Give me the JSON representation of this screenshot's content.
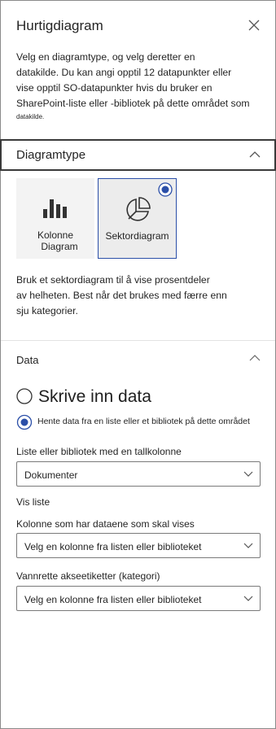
{
  "header": {
    "title": "Hurtigdiagram",
    "close_icon": "close-icon"
  },
  "intro": {
    "lines": [
      "Velg en diagramtype, og velg deretter en",
      "datakilde. Du kan angi opptil 12 datapunkter eller",
      "vise opptil SO-datapunkter hvis du bruker en",
      "SharePoint-liste eller -bibliotek på dette området som"
    ],
    "tiny": "datakilde."
  },
  "chart_type_section": {
    "label": "Diagramtype",
    "icon": "chevron-up-icon"
  },
  "chart_types": {
    "column": {
      "line1": "Kolonne",
      "line2": "Diagram",
      "icon": "column-chart-icon"
    },
    "pie": {
      "label": "Sektordiagram",
      "icon": "pie-chart-icon",
      "selected": true
    }
  },
  "description": {
    "lines": [
      "Bruk et sektordiagram til å vise prosentdeler",
      "av helheten. Best når det brukes med færre enn",
      "sju kategorier."
    ]
  },
  "data_section": {
    "label": "Data",
    "icon": "chevron-up-icon"
  },
  "source": {
    "manual_label": "Skrive inn data",
    "list_label": "Hente data fra en liste eller et bibliotek på dette området",
    "selected": "list"
  },
  "fields": {
    "list_label": "Liste eller bibliotek med en tallkolonne",
    "list_value": "Dokumenter",
    "show_list": "Vis liste",
    "column_label": "Kolonne som har dataene som skal vises",
    "column_value": "Velg en kolonne fra listen eller biblioteket",
    "axis_label": "Vannrette akseetiketter (kategori)",
    "axis_value": "Velg en kolonne fra listen eller biblioteket"
  },
  "colors": {
    "accent": "#2b4fa8",
    "text": "#242424",
    "tile_bg": "#f3f3f3"
  }
}
